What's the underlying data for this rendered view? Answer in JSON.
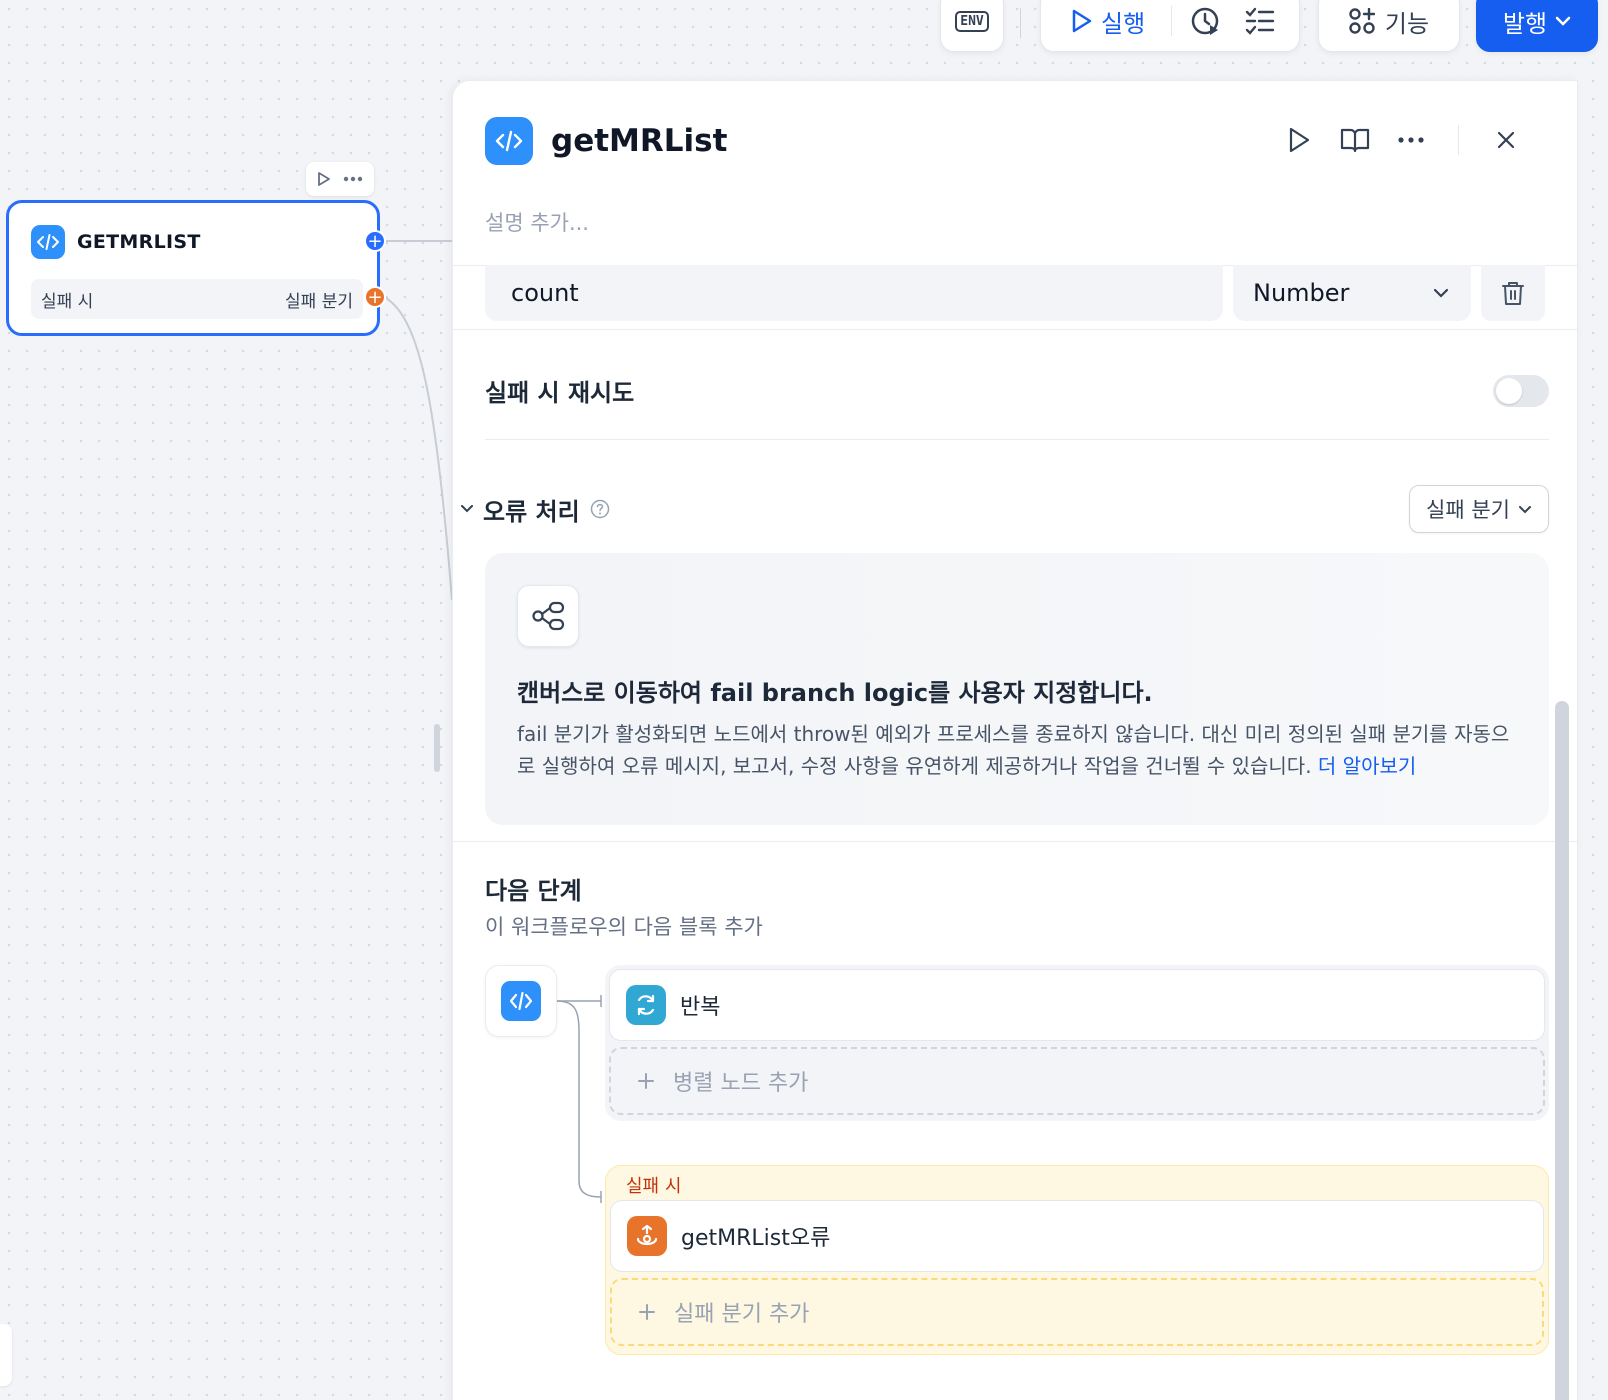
{
  "toolbar": {
    "env_label": "ENV",
    "run_label": "실행",
    "features_label": "기능",
    "publish_label": "발행"
  },
  "canvas_node": {
    "title": "GETMRLIST",
    "fail_row_left": "실패 시",
    "fail_row_right": "실패 분기"
  },
  "panel": {
    "title": "getMRList",
    "description_placeholder": "설명 추가...",
    "variable": {
      "name": "count",
      "type": "Number"
    },
    "retry_label": "실패 시 재시도",
    "retry_enabled": false,
    "error_handling": {
      "label": "오류 처리",
      "select_value": "실패 분기"
    },
    "info": {
      "title": "캔버스로 이동하여 fail branch logic를 사용자 지정합니다.",
      "body": "fail 분기가 활성화되면 노드에서 throw된 예외가 프로세스를 종료하지 않습니다. 대신 미리 정의된 실패 분기를 자동으로 실행하여 오류 메시지, 보고서, 수정 사항을 유연하게 제공하거나 작업을 건너뛸 수 있습니다.",
      "link": "더 알아보기"
    },
    "next_step": {
      "title": "다음 단계",
      "subtitle": "이 워크플로우의 다음 블록 추가",
      "main_branch_item": "반복",
      "add_parallel": "병렬 노드 추가",
      "fail_label": "실패 시",
      "fail_branch_item": "getMRList오류",
      "add_fail_branch": "실패 분기 추가"
    }
  },
  "colors": {
    "accent": "#155eef",
    "node_border": "#296dff",
    "code_icon": "#2e90fa",
    "loop_icon": "#31a8d4",
    "fail_icon": "#e8742b"
  }
}
